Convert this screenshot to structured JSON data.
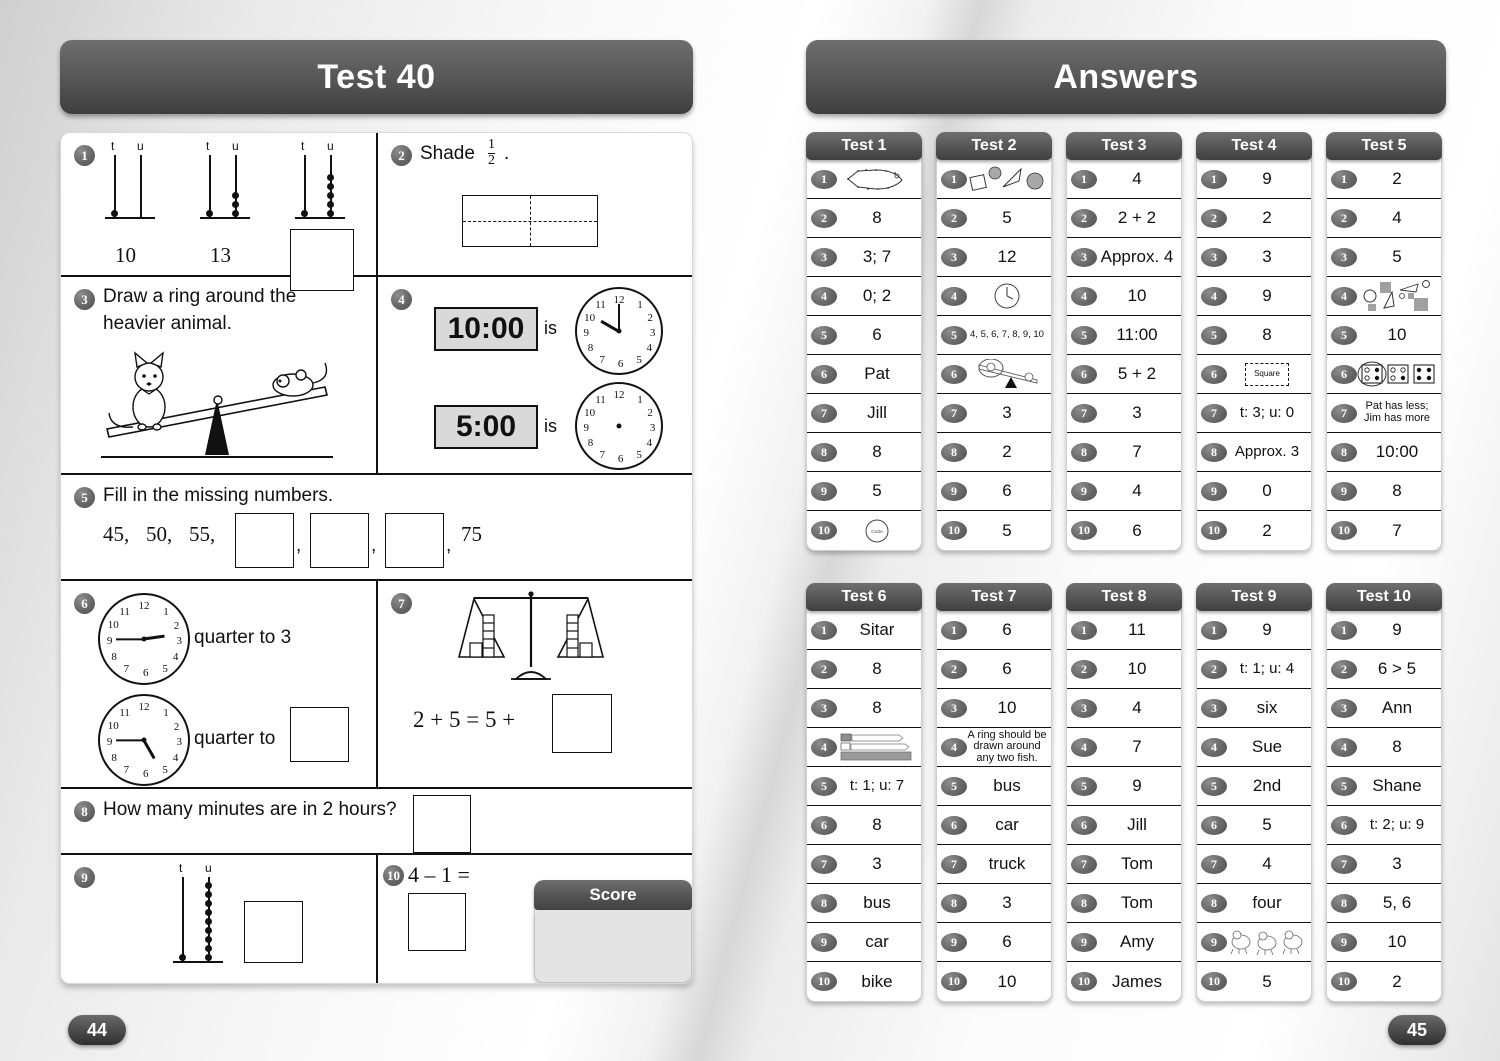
{
  "left_page": {
    "title": "Test 40",
    "page_number": "44",
    "score_label": "Score",
    "questions": [
      {
        "n": "1",
        "type": "abacus-series",
        "abacuses": [
          {
            "tens": 1,
            "units": 0,
            "label": "10",
            "col_labels": [
              "t",
              "u"
            ]
          },
          {
            "tens": 1,
            "units": 3,
            "label": "13",
            "col_labels": [
              "t",
              "u"
            ]
          },
          {
            "tens": 1,
            "units": 5,
            "label": "",
            "col_labels": [
              "t",
              "u"
            ],
            "answer_box": true
          }
        ]
      },
      {
        "n": "2",
        "type": "shade-fraction",
        "text": "Shade",
        "fraction_numerator": "1",
        "fraction_denominator": "2",
        "trailing": "."
      },
      {
        "n": "3",
        "type": "seesaw",
        "text_line1": "Draw a ring around the",
        "text_line2": "heavier animal.",
        "left_animal": "cat",
        "right_animal": "mouse"
      },
      {
        "n": "4",
        "type": "digital-to-clock",
        "items": [
          {
            "digital": "10:00",
            "is_label": "is",
            "clock_hour": 10,
            "clock_minute": 0,
            "hands": true
          },
          {
            "digital": "5:00",
            "is_label": "is",
            "clock_hour": null,
            "clock_minute": null,
            "hands": false
          }
        ]
      },
      {
        "n": "5",
        "type": "sequence",
        "text": "Fill in the missing numbers.",
        "given": [
          "45",
          "50",
          "55"
        ],
        "blanks": 3,
        "last": "75",
        "separator": ","
      },
      {
        "n": "6",
        "type": "clock-quarter",
        "items": [
          {
            "label": "quarter to 3",
            "hands": true,
            "hour_angle": 82,
            "minute_angle": 270,
            "has_box": false
          },
          {
            "label": "quarter to",
            "hands": true,
            "hour_angle": 130,
            "minute_angle": 270,
            "has_box": true
          }
        ]
      },
      {
        "n": "7",
        "type": "balance-equation",
        "equation_left": "2 + 5  =  5 +",
        "has_box": true
      },
      {
        "n": "8",
        "type": "word-problem",
        "text": "How many minutes are in 2 hours?",
        "has_box": true
      },
      {
        "n": "9",
        "type": "abacus-single",
        "tens": 1,
        "units": 9,
        "col_labels": [
          "t",
          "u"
        ],
        "has_box": true
      },
      {
        "n": "10",
        "type": "subtraction",
        "text": "4 – 1 =",
        "has_box": true
      }
    ]
  },
  "right_page": {
    "title": "Answers",
    "page_number": "45",
    "rows": [
      [
        {
          "name": "Test 1",
          "answers": [
            {
              "n": "1",
              "value": "",
              "art": "dot-to-dot-fish"
            },
            {
              "n": "2",
              "value": "8"
            },
            {
              "n": "3",
              "value": "3; 7"
            },
            {
              "n": "4",
              "value": "0; 2"
            },
            {
              "n": "5",
              "value": "6"
            },
            {
              "n": "6",
              "value": "Pat"
            },
            {
              "n": "7",
              "value": "Jill"
            },
            {
              "n": "8",
              "value": "8"
            },
            {
              "n": "9",
              "value": "5"
            },
            {
              "n": "10",
              "value": "",
              "art": "circle-label"
            }
          ]
        },
        {
          "name": "Test 2",
          "answers": [
            {
              "n": "1",
              "value": "",
              "art": "shapes-row"
            },
            {
              "n": "2",
              "value": "5"
            },
            {
              "n": "3",
              "value": "12"
            },
            {
              "n": "4",
              "value": "",
              "art": "small-clock"
            },
            {
              "n": "5",
              "value": "4, 5, 6, 7, 8, 9, 10",
              "size": "xsmall"
            },
            {
              "n": "6",
              "value": "",
              "art": "seesaw-ring"
            },
            {
              "n": "7",
              "value": "3"
            },
            {
              "n": "8",
              "value": "2"
            },
            {
              "n": "9",
              "value": "6"
            },
            {
              "n": "10",
              "value": "5"
            }
          ]
        },
        {
          "name": "Test 3",
          "answers": [
            {
              "n": "1",
              "value": "4"
            },
            {
              "n": "2",
              "value": "2 + 2"
            },
            {
              "n": "3",
              "value": "Approx. 4"
            },
            {
              "n": "4",
              "value": "10"
            },
            {
              "n": "5",
              "value": "11:00"
            },
            {
              "n": "6",
              "value": "5 + 2"
            },
            {
              "n": "7",
              "value": "3"
            },
            {
              "n": "8",
              "value": "7"
            },
            {
              "n": "9",
              "value": "4"
            },
            {
              "n": "10",
              "value": "6"
            }
          ]
        },
        {
          "name": "Test 4",
          "answers": [
            {
              "n": "1",
              "value": "9"
            },
            {
              "n": "2",
              "value": "2"
            },
            {
              "n": "3",
              "value": "3"
            },
            {
              "n": "4",
              "value": "9"
            },
            {
              "n": "5",
              "value": "8"
            },
            {
              "n": "6",
              "value": "Square",
              "art": "dashed-square"
            },
            {
              "n": "7",
              "value": "t: 3; u: 0"
            },
            {
              "n": "8",
              "value": "Approx. 3"
            },
            {
              "n": "9",
              "value": "0"
            },
            {
              "n": "10",
              "value": "2"
            }
          ]
        },
        {
          "name": "Test 5",
          "answers": [
            {
              "n": "1",
              "value": "2"
            },
            {
              "n": "2",
              "value": "4"
            },
            {
              "n": "3",
              "value": "5"
            },
            {
              "n": "4",
              "value": "",
              "art": "shapes-scatter"
            },
            {
              "n": "5",
              "value": "10"
            },
            {
              "n": "6",
              "value": "",
              "art": "dice-row"
            },
            {
              "n": "7",
              "value": "Pat has less;\nJim has more",
              "size": "small"
            },
            {
              "n": "8",
              "value": "10:00"
            },
            {
              "n": "9",
              "value": "8"
            },
            {
              "n": "10",
              "value": "7"
            }
          ]
        }
      ],
      [
        {
          "name": "Test 6",
          "answers": [
            {
              "n": "1",
              "value": "Sitar"
            },
            {
              "n": "2",
              "value": "8"
            },
            {
              "n": "3",
              "value": "8"
            },
            {
              "n": "4",
              "value": "",
              "art": "ribbons"
            },
            {
              "n": "5",
              "value": "t: 1; u: 7"
            },
            {
              "n": "6",
              "value": "8"
            },
            {
              "n": "7",
              "value": "3"
            },
            {
              "n": "8",
              "value": "bus"
            },
            {
              "n": "9",
              "value": "car"
            },
            {
              "n": "10",
              "value": "bike"
            }
          ]
        },
        {
          "name": "Test 7",
          "answers": [
            {
              "n": "1",
              "value": "6"
            },
            {
              "n": "2",
              "value": "6"
            },
            {
              "n": "3",
              "value": "10"
            },
            {
              "n": "4",
              "value": "A ring should be drawn around any two fish.",
              "size": "small"
            },
            {
              "n": "5",
              "value": "bus"
            },
            {
              "n": "6",
              "value": "car"
            },
            {
              "n": "7",
              "value": "truck"
            },
            {
              "n": "8",
              "value": "3"
            },
            {
              "n": "9",
              "value": "6"
            },
            {
              "n": "10",
              "value": "10"
            }
          ]
        },
        {
          "name": "Test 8",
          "answers": [
            {
              "n": "1",
              "value": "11"
            },
            {
              "n": "2",
              "value": "10"
            },
            {
              "n": "3",
              "value": "4"
            },
            {
              "n": "4",
              "value": "7"
            },
            {
              "n": "5",
              "value": "9"
            },
            {
              "n": "6",
              "value": "Jill"
            },
            {
              "n": "7",
              "value": "Tom"
            },
            {
              "n": "8",
              "value": "Tom"
            },
            {
              "n": "9",
              "value": "Amy"
            },
            {
              "n": "10",
              "value": "James"
            }
          ]
        },
        {
          "name": "Test 9",
          "answers": [
            {
              "n": "1",
              "value": "9"
            },
            {
              "n": "2",
              "value": "t: 1; u: 4"
            },
            {
              "n": "3",
              "value": "six"
            },
            {
              "n": "4",
              "value": "Sue"
            },
            {
              "n": "5",
              "value": "2nd"
            },
            {
              "n": "6",
              "value": "5"
            },
            {
              "n": "7",
              "value": "4"
            },
            {
              "n": "8",
              "value": "four"
            },
            {
              "n": "9",
              "value": "",
              "art": "race-scene"
            },
            {
              "n": "10",
              "value": "5"
            }
          ]
        },
        {
          "name": "Test 10",
          "answers": [
            {
              "n": "1",
              "value": "9"
            },
            {
              "n": "2",
              "value": "6 > 5"
            },
            {
              "n": "3",
              "value": "Ann"
            },
            {
              "n": "4",
              "value": "8"
            },
            {
              "n": "5",
              "value": "Shane"
            },
            {
              "n": "6",
              "value": "t: 2; u: 9"
            },
            {
              "n": "7",
              "value": "3"
            },
            {
              "n": "8",
              "value": "5, 6"
            },
            {
              "n": "9",
              "value": "10"
            },
            {
              "n": "10",
              "value": "2"
            }
          ]
        }
      ]
    ]
  },
  "colors": {
    "bar_dark": "#5a5a5a",
    "bar_darker": "#3f3f3f",
    "ink": "#111111",
    "digital_bg": "#d9d9d9",
    "score_bg": "#e4e4e4"
  }
}
